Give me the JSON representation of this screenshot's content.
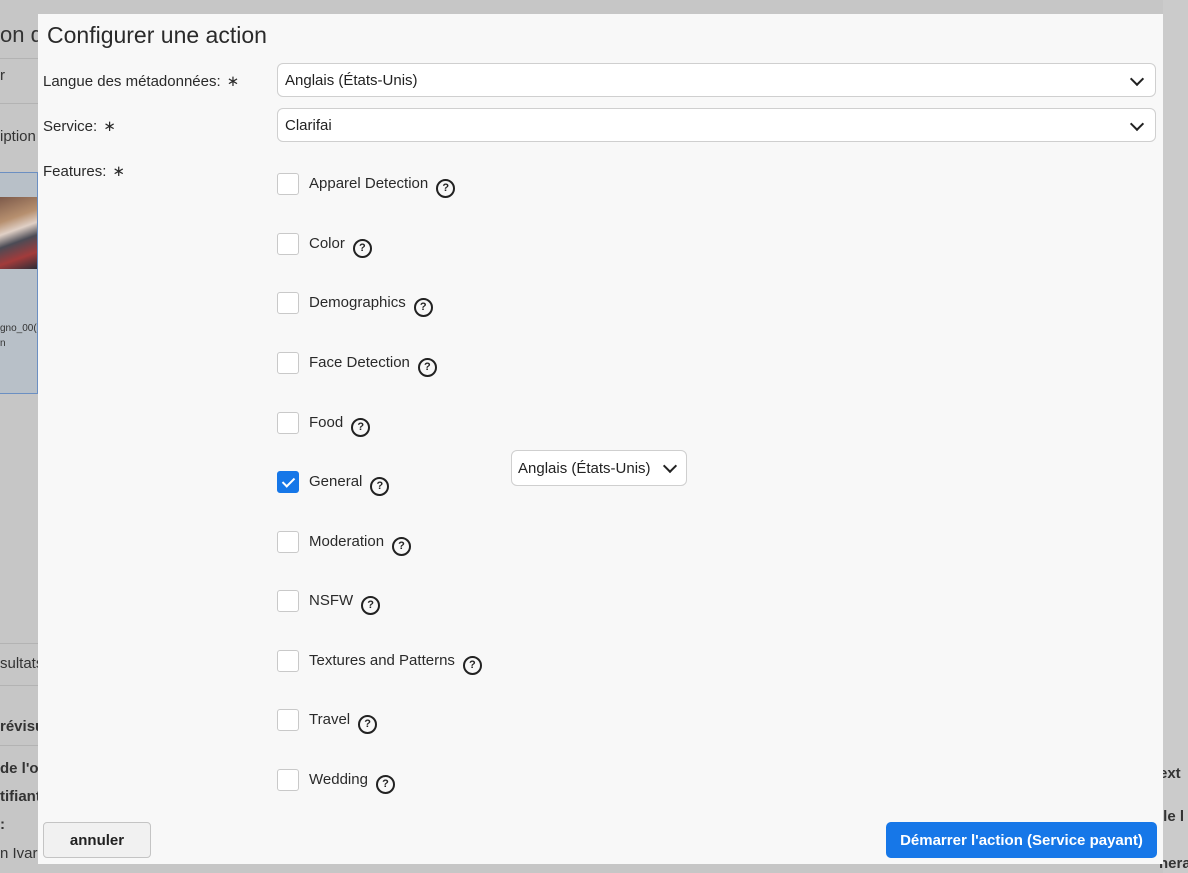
{
  "background": {
    "fragments": [
      "on d",
      "r",
      "iption",
      "gno_00(",
      "n",
      "sultats",
      "révisu",
      "de l'o",
      "tifiant",
      ":",
      "n Ivar",
      "ext",
      "ile l",
      "nera"
    ]
  },
  "modal": {
    "title": "Configurer une action",
    "metadata_language": {
      "label": "Langue des métadonnées:",
      "required_mark": "∗",
      "value": "Anglais (États-Unis)"
    },
    "service": {
      "label": "Service:",
      "required_mark": "∗",
      "value": "Clarifai"
    },
    "features": {
      "label": "Features:",
      "required_mark": "∗",
      "help_glyph": "?",
      "items": [
        {
          "label": "Apparel Detection",
          "checked": false
        },
        {
          "label": "Color",
          "checked": false
        },
        {
          "label": "Demographics",
          "checked": false
        },
        {
          "label": "Face Detection",
          "checked": false
        },
        {
          "label": "Food",
          "checked": false
        },
        {
          "label": "General",
          "checked": true
        },
        {
          "label": "Moderation",
          "checked": false
        },
        {
          "label": "NSFW",
          "checked": false
        },
        {
          "label": "Textures and Patterns",
          "checked": false
        },
        {
          "label": "Travel",
          "checked": false
        },
        {
          "label": "Wedding",
          "checked": false
        }
      ],
      "general_language": "Anglais (États-Unis)"
    },
    "cancel_label": "annuler",
    "start_label": "Démarrer l'action (Service payant)",
    "colors": {
      "accent": "#1677e8",
      "modal_bg": "#f8f8f8",
      "backdrop": "#c6c6c6"
    }
  }
}
